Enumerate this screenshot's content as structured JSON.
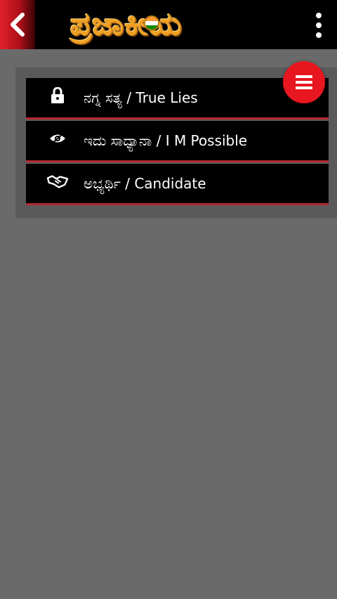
{
  "header": {
    "title": "ಪ್ರಜಾಕೀಯ",
    "back_icon": "chevron-left-icon",
    "more_icon": "more-vertical-icon",
    "logo_flag_colors": [
      "#ff9933",
      "#ffffff",
      "#138808"
    ]
  },
  "menu": {
    "items": [
      {
        "icon": "lock-icon",
        "label": "ನಗ್ನ ಸತ್ಯ / True Lies"
      },
      {
        "icon": "eye-icon",
        "label": "ಇದು ಸಾಧ್ಯಾನಾ / I M Possible"
      },
      {
        "icon": "handshake-icon",
        "label": "ಅಭ್ಯರ್ಥಿ / Candidate"
      }
    ]
  },
  "fab": {
    "icon": "hamburger-menu-icon"
  },
  "colors": {
    "accent_red": "#e8161f",
    "item_border": "#b4282e",
    "background": "#6a6a6a",
    "panel": "#5a5a5a",
    "logo_gold": "#f0a020"
  }
}
